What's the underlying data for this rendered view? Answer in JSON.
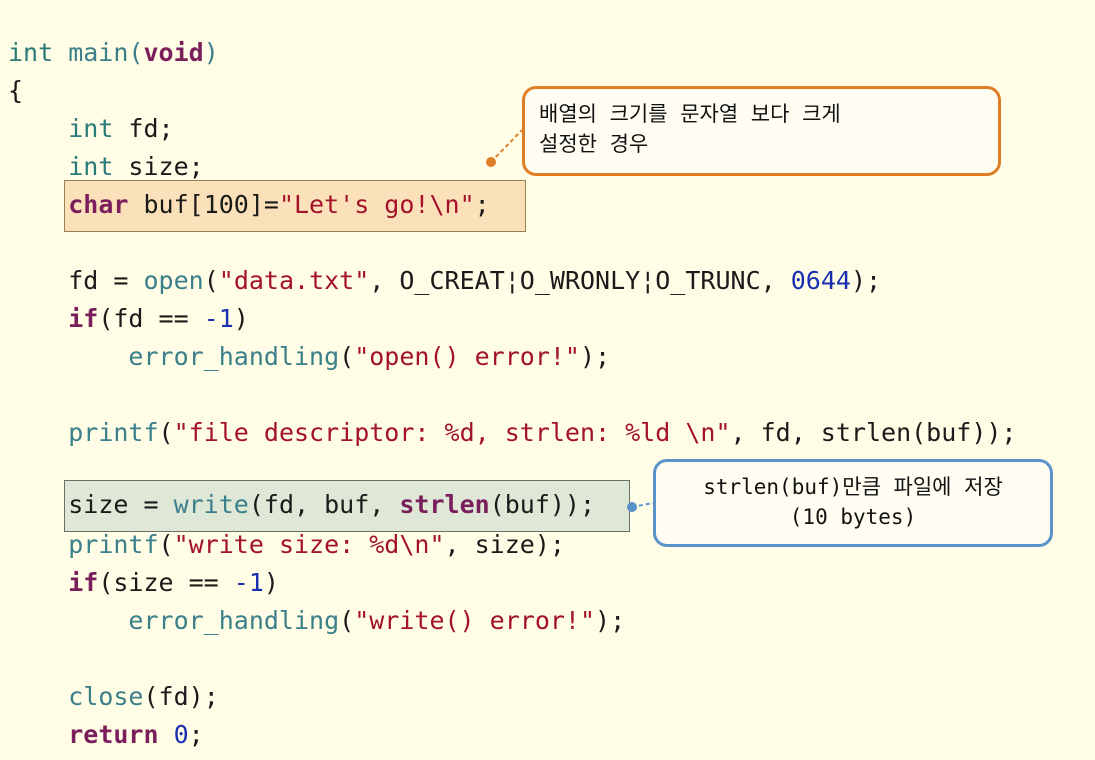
{
  "code_lines": {
    "l1": [
      "int",
      " main(",
      "void",
      ")"
    ],
    "l2": "{",
    "l3": [
      "int",
      " fd;"
    ],
    "l4": [
      "int",
      " size;"
    ],
    "l5": [
      "char",
      " buf[100]=",
      "\"Let's go!\\n\"",
      ";"
    ],
    "l7": [
      "fd = ",
      "open",
      "(",
      "\"data.txt\"",
      ", O_CREAT¦O_WRONLY¦O_TRUNC, ",
      "0644",
      ");"
    ],
    "l8": [
      "if",
      "(fd == ",
      "-1",
      ")"
    ],
    "l9": [
      "error_handling",
      "(",
      "\"open() error!\"",
      ");"
    ],
    "l11": [
      "printf",
      "(",
      "\"file descriptor: %d, strlen: %ld \\n\"",
      ", fd, strlen(buf));"
    ],
    "l13": [
      "size = ",
      "write",
      "(fd, buf, ",
      "strlen",
      "(buf));"
    ],
    "l14": [
      "printf",
      "(",
      "\"write size: %d\\n\"",
      ", size);"
    ],
    "l15": [
      "if",
      "(size == ",
      "-1",
      ")"
    ],
    "l16": [
      "error_handling",
      "(",
      "\"write() error!\"",
      ");"
    ],
    "l18": [
      "close",
      "(fd);"
    ],
    "l19": [
      "return",
      " ",
      "0",
      ";"
    ]
  },
  "callouts": {
    "buffer_note_line1": "배열의 크기를 문자열 보다 크게",
    "buffer_note_line2": "설정한 경우",
    "write_note_line1": "strlen(buf)만큼 파일에 저장",
    "write_note_line2": "(10 bytes)"
  },
  "colors": {
    "background": "#fffde6",
    "keyword": "#2a7a7a",
    "string": "#a3122a",
    "number": "#1a2fb0",
    "orange_highlight": "#fbe1b9",
    "green_highlight": "#dfe8d6",
    "orange_border": "#e07e27",
    "blue_border": "#5a93c9"
  }
}
